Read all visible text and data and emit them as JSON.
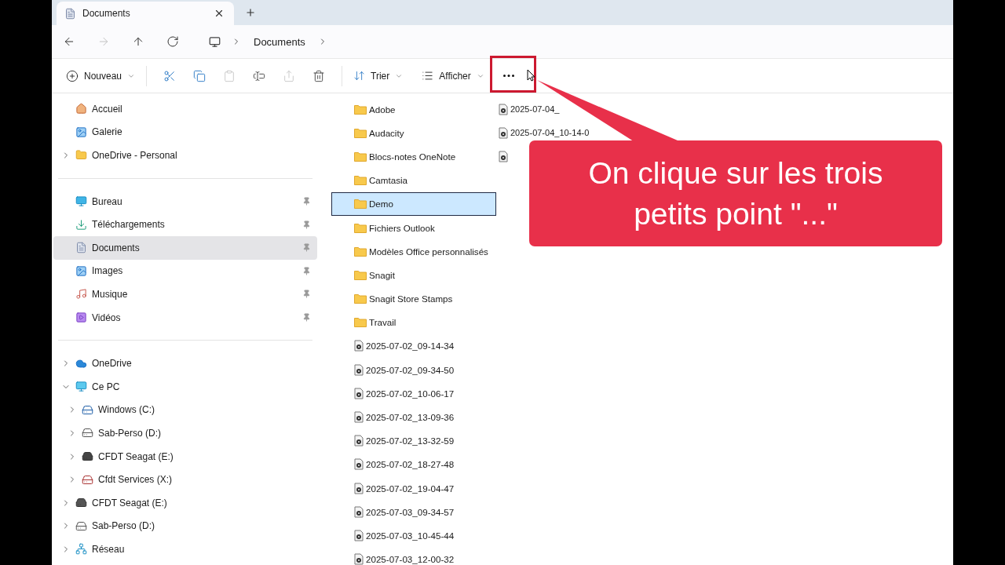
{
  "tab": {
    "title": "Documents",
    "selected": true
  },
  "nav_buttons": [
    {
      "disabled": false
    },
    {
      "disabled": true
    },
    {
      "disabled": false
    },
    {
      "disabled": false
    }
  ],
  "breadcrumb": {
    "segments": [
      "Documents"
    ]
  },
  "toolbar": {
    "new_label": "Nouveau",
    "actions": [
      {
        "disabled": false
      },
      {
        "disabled": false
      },
      {
        "disabled": true
      },
      {
        "disabled": false
      },
      {
        "disabled": true
      },
      {
        "disabled": false
      }
    ],
    "sort_label": "Trier",
    "view_label": "Afficher"
  },
  "sidebar": {
    "quick_links": [
      {
        "label": "Accueil",
        "kind": "link",
        "selected": false
      },
      {
        "label": "Galerie",
        "kind": "link",
        "selected": false
      },
      {
        "label": "OneDrive - Personal",
        "kind": "tree",
        "expanded": false,
        "selected": false
      }
    ],
    "pinned": [
      {
        "label": "Bureau",
        "pinned": true,
        "selected": false
      },
      {
        "label": "Téléchargements",
        "pinned": true,
        "selected": false
      },
      {
        "label": "Documents",
        "pinned": true,
        "selected": true
      },
      {
        "label": "Images",
        "pinned": true,
        "selected": false
      },
      {
        "label": "Musique",
        "pinned": true,
        "selected": false
      },
      {
        "label": "Vidéos",
        "pinned": true,
        "selected": false
      }
    ],
    "tree": [
      {
        "label": "OneDrive",
        "expanded": false,
        "selected": false
      },
      {
        "label": "Ce PC",
        "expanded": true,
        "selected": false,
        "children": [
          {
            "label": "Windows (C:)",
            "expanded": false,
            "selected": false
          },
          {
            "label": "Sab-Perso (D:)",
            "expanded": false,
            "selected": false
          },
          {
            "label": "CFDT Seagat (E:)",
            "expanded": false,
            "selected": false
          },
          {
            "label": "Cfdt Services (X:)",
            "expanded": false,
            "selected": false
          }
        ]
      },
      {
        "label": "CFDT Seagat (E:)",
        "expanded": false,
        "selected": false
      },
      {
        "label": "Sab-Perso (D:)",
        "expanded": false,
        "selected": false
      },
      {
        "label": "Réseau",
        "expanded": false,
        "selected": false
      }
    ]
  },
  "file_columns": [
    {
      "items": [
        {
          "name": "Adobe",
          "kind": "folder",
          "selected": false
        },
        {
          "name": "Audacity",
          "kind": "folder",
          "selected": false
        },
        {
          "name": "Blocs-notes OneNote",
          "kind": "folder",
          "selected": false
        },
        {
          "name": "Camtasia",
          "kind": "folder",
          "selected": false
        },
        {
          "name": "Demo",
          "kind": "folder",
          "selected": true
        },
        {
          "name": "Fichiers Outlook",
          "kind": "folder",
          "selected": false
        },
        {
          "name": "Modèles Office personnalisés",
          "kind": "folder",
          "selected": false
        },
        {
          "name": "Snagit",
          "kind": "folder",
          "selected": false
        },
        {
          "name": "Snagit Store Stamps",
          "kind": "folder",
          "selected": false
        },
        {
          "name": "Travail",
          "kind": "folder",
          "selected": false
        },
        {
          "name": "2025-07-02_09-14-34",
          "kind": "video",
          "selected": false
        },
        {
          "name": "2025-07-02_09-34-50",
          "kind": "video",
          "selected": false
        },
        {
          "name": "2025-07-02_10-06-17",
          "kind": "video",
          "selected": false
        },
        {
          "name": "2025-07-02_13-09-36",
          "kind": "video",
          "selected": false
        },
        {
          "name": "2025-07-02_13-32-59",
          "kind": "video",
          "selected": false
        },
        {
          "name": "2025-07-02_18-27-48",
          "kind": "video",
          "selected": false
        },
        {
          "name": "2025-07-02_19-04-47",
          "kind": "video",
          "selected": false
        },
        {
          "name": "2025-07-03_09-34-57",
          "kind": "video",
          "selected": false
        },
        {
          "name": "2025-07-03_10-45-44",
          "kind": "video",
          "selected": false
        },
        {
          "name": "2025-07-03_12-00-32",
          "kind": "video",
          "selected": false
        }
      ]
    },
    {
      "items": [
        {
          "name": "2025-07-04_",
          "kind": "video",
          "selected": false
        },
        {
          "name": "2025-07-04_10-14-0",
          "kind": "video",
          "selected": false
        },
        {
          "kind": "video",
          "selected": false
        }
      ]
    }
  ],
  "annotation": {
    "text": "On clique sur les trois petits point \"...\"",
    "highlight": true,
    "cursor": true
  }
}
